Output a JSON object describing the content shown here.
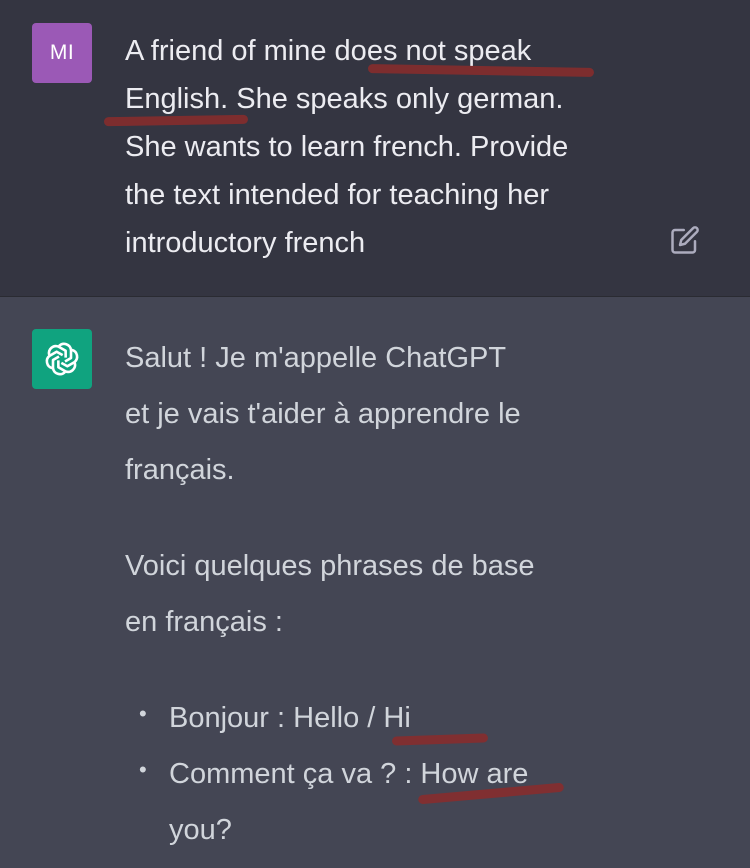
{
  "user_message": {
    "avatar_initials": "MI",
    "lines": [
      "A friend of mine does not speak",
      "English. She speaks only german.",
      "She wants to learn french. Provide",
      "the text intended for teaching her",
      "introductory french"
    ],
    "edit_icon": "edit-icon"
  },
  "assistant_message": {
    "avatar_icon": "chatgpt-logo-icon",
    "paragraph1": [
      "Salut ! Je m'appelle ChatGPT",
      "et je vais t'aider à apprendre le",
      "français."
    ],
    "paragraph2": [
      "Voici quelques phrases de base",
      "en français :"
    ],
    "bullets": [
      {
        "lines": [
          "Bonjour : Hello / Hi"
        ]
      },
      {
        "lines": [
          "Comment ça va ? : How are",
          "you?"
        ]
      }
    ]
  },
  "colors": {
    "user_bg": "#343541",
    "assistant_bg": "#444654",
    "user_avatar": "#9b59b6",
    "assistant_avatar": "#10a37f",
    "annotation_underline": "#8b2b2b"
  }
}
